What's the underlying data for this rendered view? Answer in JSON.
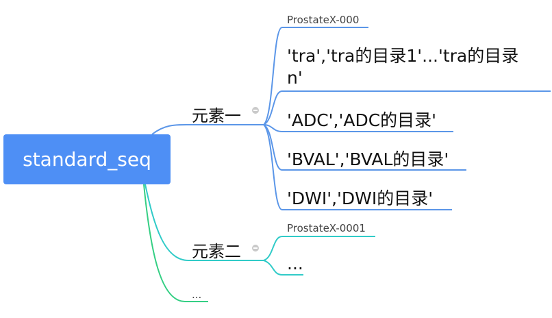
{
  "colors": {
    "root_fill": "#4e8ff5",
    "branch_blue": "#5b96e8",
    "branch_teal": "#31cbc8",
    "branch_green": "#35cf84",
    "collapse_dot": "#c9c9c9"
  },
  "root": {
    "label": "standard_seq"
  },
  "branches": [
    {
      "label": "元素一",
      "collapse_icon": "minus-circle-icon",
      "children": [
        "ProstateX-000",
        "'tra','tra的目录1'...'tra的目录",
        "n'",
        "'ADC','ADC的目录'",
        "'BVAL','BVAL的目录'",
        "'DWI','DWI的目录'"
      ]
    },
    {
      "label": "元素二",
      "collapse_icon": "minus-circle-icon",
      "children": [
        "ProstateX-0001",
        "..."
      ]
    },
    {
      "label": "..."
    }
  ]
}
